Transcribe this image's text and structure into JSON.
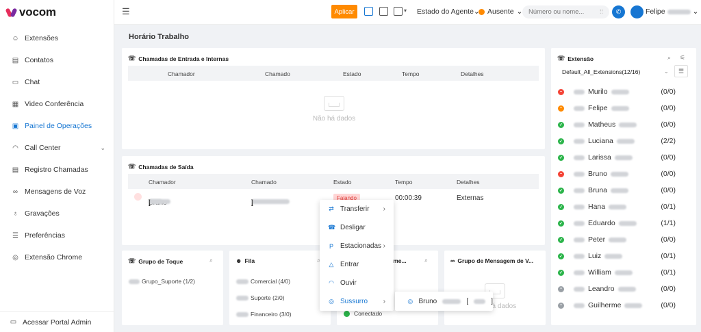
{
  "brand": {
    "name": "vocom"
  },
  "sidebar": {
    "items": [
      {
        "label": "Extensões",
        "icon": "users-icon",
        "glyph": "☺"
      },
      {
        "label": "Contatos",
        "icon": "address-book-icon",
        "glyph": "▤"
      },
      {
        "label": "Chat",
        "icon": "chat-icon",
        "glyph": "▭"
      },
      {
        "label": "Video Conferência",
        "icon": "monitor-icon",
        "glyph": "▦"
      },
      {
        "label": "Painel de Operações",
        "icon": "dashboard-icon",
        "glyph": "▣",
        "active": true
      },
      {
        "label": "Call Center",
        "icon": "headset-icon",
        "glyph": "◠",
        "has_chevron": true
      },
      {
        "label": "Registro Chamadas",
        "icon": "call-log-icon",
        "glyph": "▤"
      },
      {
        "label": "Mensagens de Voz",
        "icon": "voicemail-icon",
        "glyph": "∞"
      },
      {
        "label": "Gravações",
        "icon": "microphone-icon",
        "glyph": "♁"
      },
      {
        "label": "Preferências",
        "icon": "preferences-icon",
        "glyph": "☰"
      },
      {
        "label": "Extensão Chrome",
        "icon": "chrome-icon",
        "glyph": "◎"
      }
    ],
    "footer": "Acessar Portal Admin"
  },
  "header": {
    "apply": "Aplicar",
    "agent_state": "Estado do Agente",
    "absent": "Ausente",
    "search_placeholder": "Número ou nome...",
    "user": "Felipe",
    "avatar_letter": "👤"
  },
  "page_title": "Horário Trabalho",
  "inbound": {
    "title": "Chamadas de Entrada e Internas",
    "columns": [
      "Chamador",
      "Chamado",
      "Estado",
      "Tempo",
      "Detalhes"
    ],
    "empty": "Não há dados"
  },
  "outbound": {
    "title": "Chamadas de Saída",
    "columns": [
      "Chamador",
      "Chamado",
      "Estado",
      "Tempo",
      "Detalhes"
    ],
    "row": {
      "caller": "Bruno",
      "caller_bracket": "[",
      "caller_bracket_end": "]",
      "called_bracket": "[",
      "called_bracket_end": "]",
      "state": "Falando",
      "time": "00:00:39",
      "details": "Externas"
    }
  },
  "ring_group": {
    "title": "Grupo de Toque",
    "items": [
      "Grupo_Suporte (1/2)"
    ]
  },
  "queue": {
    "title": "Fila",
    "items": [
      "Comercial (4/0)",
      "Suporte (2/0)",
      "Financeiro (3/0)"
    ]
  },
  "parking": {
    "title": "cioname...",
    "items": [
      "Conectado"
    ]
  },
  "voicemail_group": {
    "title": "Grupo de Mensagem de V...",
    "empty": "Não há dados"
  },
  "extensions": {
    "title": "Extensão",
    "selected_group": "Default_All_Extensions(12/16)",
    "items": [
      {
        "name": "Murilo",
        "count": "(0/0)",
        "status": "busy",
        "color": "#f44336"
      },
      {
        "name": "Felipe",
        "count": "(0/0)",
        "status": "away",
        "color": "#ff8a00"
      },
      {
        "name": "Matheus",
        "count": "(0/0)",
        "status": "available",
        "color": "#2bb44a"
      },
      {
        "name": "Luciana",
        "count": "(2/2)",
        "status": "available",
        "color": "#2bb44a"
      },
      {
        "name": "Larissa",
        "count": "(0/0)",
        "status": "available",
        "color": "#2bb44a"
      },
      {
        "name": "Bruno",
        "count": "(0/0)",
        "status": "in-call",
        "color": "#f44336"
      },
      {
        "name": "Bruna",
        "count": "(0/0)",
        "status": "available",
        "color": "#2bb44a"
      },
      {
        "name": "Hana",
        "count": "(0/1)",
        "status": "available",
        "color": "#2bb44a"
      },
      {
        "name": "Eduardo",
        "count": "(1/1)",
        "status": "available",
        "color": "#2bb44a"
      },
      {
        "name": "Peter",
        "count": "(0/0)",
        "status": "available",
        "color": "#2bb44a"
      },
      {
        "name": "Luiz",
        "count": "(0/1)",
        "status": "available",
        "color": "#2bb44a"
      },
      {
        "name": "William",
        "count": "(0/1)",
        "status": "available",
        "color": "#2bb44a"
      },
      {
        "name": "Leandro",
        "count": "(0/0)",
        "status": "offline",
        "color": "#9aa0a6"
      },
      {
        "name": "Guilherme",
        "count": "(0/0)",
        "status": "offline",
        "color": "#9aa0a6"
      }
    ]
  },
  "context_menu": {
    "items": [
      {
        "label": "Transferir",
        "icon": "transfer-icon",
        "glyph": "⇄",
        "submenu": true
      },
      {
        "label": "Desligar",
        "icon": "hangup-icon",
        "glyph": "☎",
        "submenu": false
      },
      {
        "label": "Estacionadas",
        "icon": "parking-icon",
        "glyph": "P",
        "submenu": true
      },
      {
        "label": "Entrar",
        "icon": "join-icon",
        "glyph": "△",
        "submenu": false
      },
      {
        "label": "Ouvir",
        "icon": "headphones-icon",
        "glyph": "◠",
        "submenu": false
      },
      {
        "label": "Sussurro",
        "icon": "whisper-icon",
        "glyph": "◎",
        "submenu": true,
        "active": true
      }
    ],
    "submenu": {
      "name": "Bruno",
      "bracket": "[",
      "bracket_end": "]"
    }
  }
}
